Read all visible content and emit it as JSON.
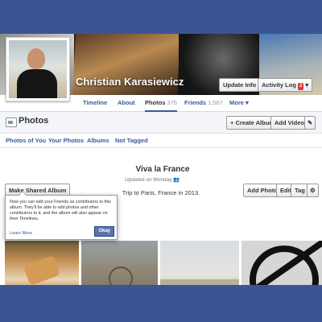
{
  "profile": {
    "name": "Christian Karasiewicz"
  },
  "header": {
    "update_info_label": "Update Info",
    "activity_log_label": "Activity Log",
    "activity_log_count": "2",
    "activity_dropdown": "▾"
  },
  "nav": {
    "tabs": [
      {
        "label": "Timeline",
        "count": ""
      },
      {
        "label": "About",
        "count": ""
      },
      {
        "label": "Photos",
        "count": "375"
      },
      {
        "label": "Friends",
        "count": "1,567"
      },
      {
        "label": "More ▾",
        "count": ""
      }
    ]
  },
  "photos_section": {
    "title": "Photos",
    "create_album_label": "+ Create Album",
    "add_video_label": "Add Video",
    "edit_icon": "pencil-icon",
    "subtabs": [
      "Photos of You",
      "Your Photos",
      "Albums",
      "Not Tagged"
    ]
  },
  "album_toolbar": {
    "make_shared_album_label": "Make Shared Album",
    "add_photos_label": "Add Photos",
    "edit_label": "Edit",
    "tag_label": "Tag",
    "settings_icon": "gear-icon"
  },
  "tooltip": {
    "text": "Now you can add your Friends as contributors to this album. They'll be able to add photos and other contributors to it, and the album will also appear on their Timelines.",
    "learn_more": "Learn More",
    "okay_label": "Okay"
  },
  "album": {
    "title": "Viva la France",
    "updated": "Updated on Monday",
    "privacy_icon": "people-icon",
    "description": "Trip to Paris, France in 2013."
  },
  "colors": {
    "background": "#3b5493",
    "link": "#3b5998",
    "badge": "#d8382d"
  }
}
